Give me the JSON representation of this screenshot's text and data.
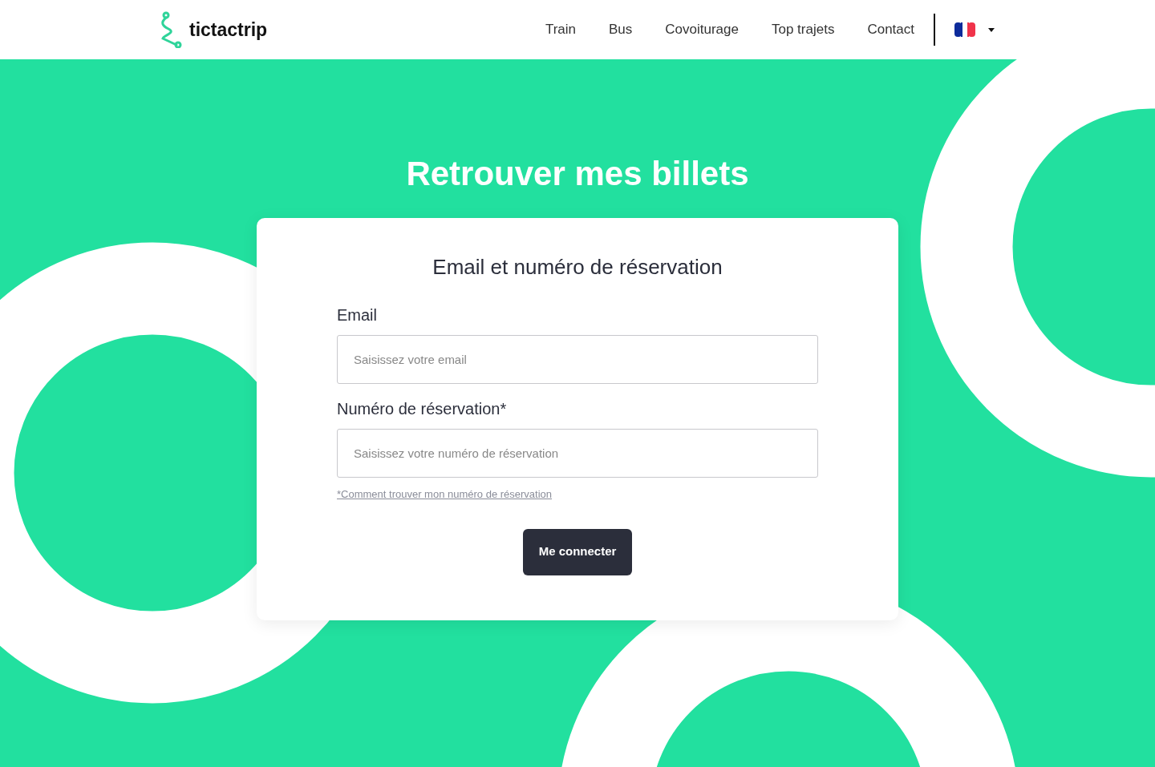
{
  "header": {
    "logo": "tictactrip",
    "nav": [
      {
        "label": "Train"
      },
      {
        "label": "Bus"
      },
      {
        "label": "Covoiturage"
      },
      {
        "label": "Top trajets"
      },
      {
        "label": "Contact"
      }
    ]
  },
  "title": "Retrouver mes billets",
  "form": {
    "heading": "Email et numéro de réservation",
    "fields": [
      {
        "label": "Email",
        "placeholder": "Saisissez votre email"
      },
      {
        "label": "Numéro de réservation*",
        "placeholder": "Saisissez votre numéro de réservation"
      }
    ],
    "help_link": "*Comment trouver mon numéro de réservation",
    "submit": "Me connecter"
  }
}
